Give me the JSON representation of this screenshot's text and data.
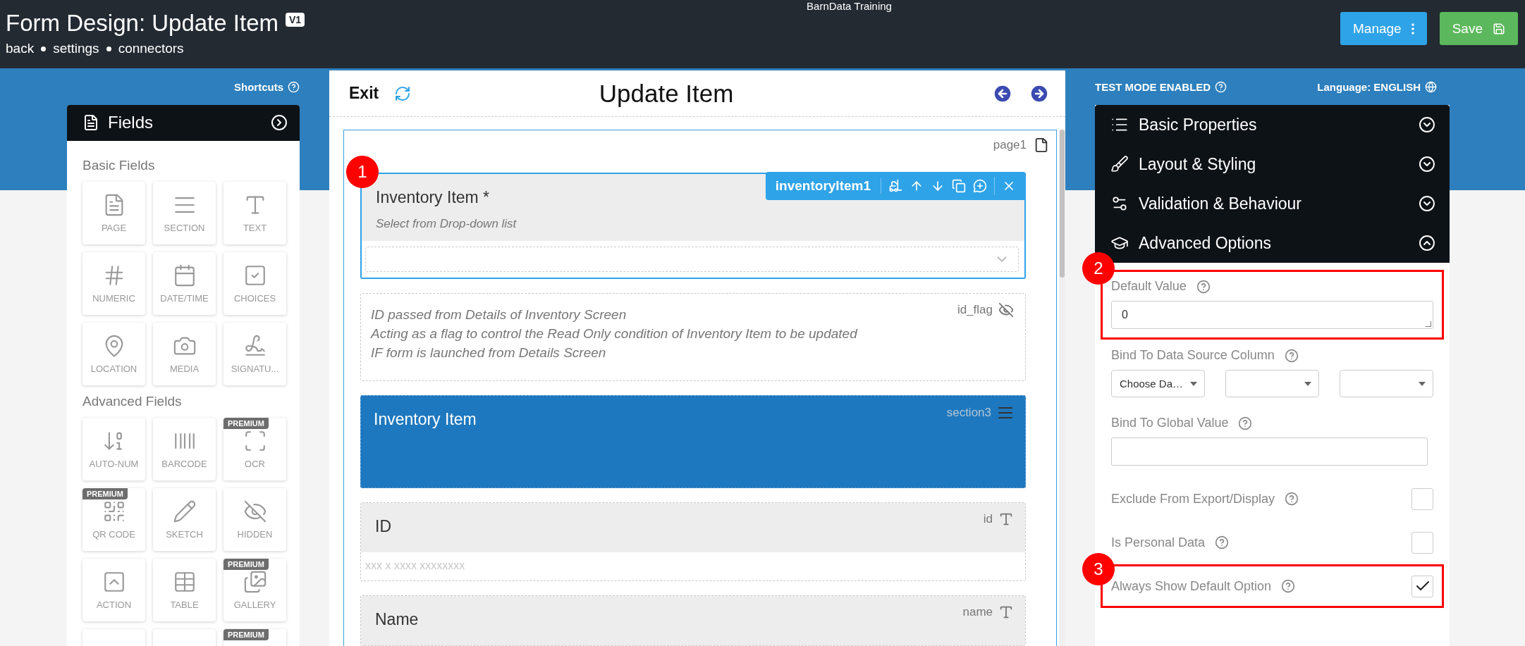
{
  "app": {
    "title": "BarnData Training"
  },
  "header": {
    "title": "Form Design: Update Item",
    "version": "V1",
    "links": [
      "back",
      "settings",
      "connectors"
    ],
    "buttons": [
      {
        "label": "Manage",
        "kind": "manage"
      },
      {
        "label": "Save",
        "kind": "save"
      }
    ]
  },
  "shortcuts": {
    "label": "Shortcuts"
  },
  "fields_panel": {
    "title": "Fields",
    "groups": [
      {
        "title": "Basic Fields",
        "tiles": [
          {
            "label": "PAGE",
            "premium": false
          },
          {
            "label": "SECTION",
            "premium": false
          },
          {
            "label": "TEXT",
            "premium": false
          },
          {
            "label": "NUMERIC",
            "premium": false
          },
          {
            "label": "DATE/TIME",
            "premium": false
          },
          {
            "label": "CHOICES",
            "premium": false
          },
          {
            "label": "LOCATION",
            "premium": false
          },
          {
            "label": "MEDIA",
            "premium": false
          },
          {
            "label": "SIGNATU...",
            "premium": false
          }
        ]
      },
      {
        "title": "Advanced Fields",
        "tiles": [
          {
            "label": "AUTO-NUM",
            "premium": false
          },
          {
            "label": "BARCODE",
            "premium": false
          },
          {
            "label": "OCR",
            "premium": true,
            "badge": "PREMIUM"
          },
          {
            "label": "QR CODE",
            "premium": true,
            "badge": "PREMIUM"
          },
          {
            "label": "SKETCH",
            "premium": false
          },
          {
            "label": "HIDDEN",
            "premium": false
          },
          {
            "label": "ACTION",
            "premium": false
          },
          {
            "label": "TABLE",
            "premium": false
          },
          {
            "label": "GALLERY",
            "premium": true,
            "badge": "PREMIUM"
          },
          {
            "premium": false
          },
          {
            "premium": false
          },
          {
            "premium": true,
            "badge": "PREMIUM"
          }
        ]
      }
    ]
  },
  "canvas": {
    "exit": "Exit",
    "title": "Update Item",
    "page": {
      "name": "page1",
      "items": [
        {
          "kind": "dropdown",
          "label": "Inventory Item *",
          "hint": "Select from Drop-down list",
          "key": "inventoryItem1",
          "selected": true,
          "marker": "1"
        },
        {
          "kind": "note",
          "lines": [
            "ID passed from Details of Inventory Screen",
            "Acting as a flag to control the Read Only condition of Inventory Item to be updated",
            "IF form is launched from Details Screen"
          ],
          "key": "id_flag",
          "hidden": true,
          "selected": false
        },
        {
          "kind": "section",
          "label": "Inventory Item",
          "key": "section3",
          "selected": false
        },
        {
          "kind": "text",
          "label": "ID",
          "key": "id",
          "placeholder": "xxx x xxxx xxxxxxxx",
          "selected": false
        },
        {
          "kind": "text",
          "label": "Name",
          "key": "name",
          "selected": false
        }
      ]
    }
  },
  "test_mode": {
    "label": "TEST MODE ENABLED"
  },
  "language": {
    "label": "Language: ENGLISH"
  },
  "properties": {
    "sections": [
      {
        "title": "Basic Properties",
        "expanded": false
      },
      {
        "title": "Layout & Styling",
        "expanded": false
      },
      {
        "title": "Validation & Behaviour",
        "expanded": false
      },
      {
        "title": "Advanced Options",
        "expanded": true
      }
    ],
    "default_value": {
      "label": "Default Value",
      "value": "0",
      "highlighted": true,
      "marker": "2"
    },
    "bind_column": {
      "label": "Bind To Data Source Column",
      "selects": [
        {
          "kind": "choice",
          "value": "Choose Da…"
        },
        {
          "kind": "blank"
        },
        {
          "kind": "blank"
        }
      ]
    },
    "bind_global": {
      "label": "Bind To Global Value"
    },
    "checkboxes": [
      {
        "label": "Exclude From Export/Display",
        "checked": false,
        "highlighted": false
      },
      {
        "label": "Is Personal Data",
        "checked": false,
        "highlighted": false
      },
      {
        "label": "Always Show Default Option",
        "checked": true,
        "highlighted": true,
        "marker": "3"
      }
    ]
  }
}
